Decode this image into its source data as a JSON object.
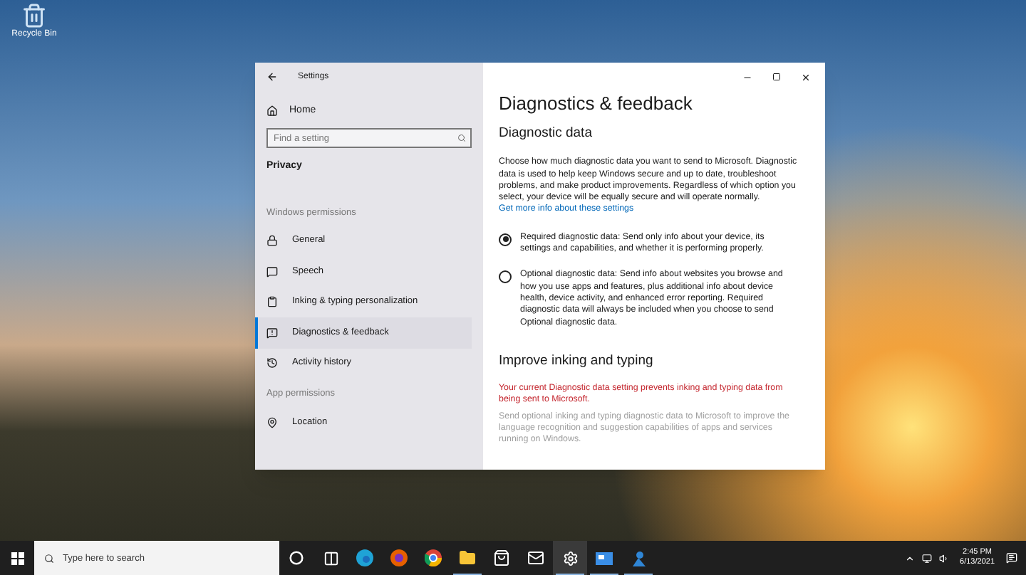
{
  "desktop_icons": [
    {
      "label": "Recycle Bin"
    }
  ],
  "window": {
    "title": "Settings"
  },
  "sidebar": {
    "home": "Home",
    "search": {
      "placeholder": "Find a setting"
    },
    "section": "Privacy",
    "groups": [
      {
        "heading": "Windows permissions",
        "items": [
          {
            "label": "General",
            "kind": "lock",
            "selected": false
          },
          {
            "label": "Speech",
            "kind": "speech",
            "selected": false
          },
          {
            "label": "Inking & typing personalization",
            "kind": "clipboard",
            "selected": false
          },
          {
            "label": "Diagnostics & feedback",
            "kind": "feedback",
            "selected": true
          },
          {
            "label": "Activity history",
            "kind": "history",
            "selected": false
          }
        ]
      },
      {
        "heading": "App permissions",
        "items": [
          {
            "label": "Location",
            "kind": "location",
            "selected": false
          }
        ]
      }
    ]
  },
  "content": {
    "title": "Diagnostics & feedback",
    "section": "Diagnostic data",
    "intro": "Choose how much diagnostic data you want to send to Microsoft. Diagnostic data is used to help keep Windows secure and up to date, troubleshoot problems, and make product improvements. Regardless of which option you select, your device will be equally secure and will operate normally.",
    "link": "Get more info about these settings",
    "options": [
      {
        "label": "Required diagnostic data: Send only info about your device, its settings and capabilities, and whether it is performing properly.",
        "selected": true
      },
      {
        "label": "Optional diagnostic data: Send info about websites you browse and how you use apps and features, plus additional info about device health, device activity, and enhanced error reporting. Required diagnostic data will always be included when you choose to send Optional diagnostic data.",
        "selected": false
      }
    ],
    "section2": "Improve inking and typing",
    "warning": "Your current Diagnostic data setting prevents inking and typing data from being sent to Microsoft.",
    "disabled_text": "Send optional inking and typing diagnostic data to Microsoft to improve the language recognition and suggestion capabilities of apps and services running on Windows."
  },
  "taskbar": {
    "search": {
      "placeholder": "Type here to search"
    },
    "apps": [
      {
        "kind": "cortana",
        "selected": false
      },
      {
        "kind": "taskview",
        "selected": false
      },
      {
        "kind": "edge",
        "selected": false
      },
      {
        "kind": "firefox",
        "selected": false
      },
      {
        "kind": "chrome",
        "selected": false
      },
      {
        "kind": "explorer",
        "selected": true
      },
      {
        "kind": "store",
        "selected": false
      },
      {
        "kind": "mail",
        "selected": false
      },
      {
        "kind": "settings",
        "selected": true
      },
      {
        "kind": "app",
        "selected": true
      },
      {
        "kind": "vs",
        "selected": true
      }
    ],
    "time": "2:45 PM",
    "date": "6/13/2021"
  }
}
